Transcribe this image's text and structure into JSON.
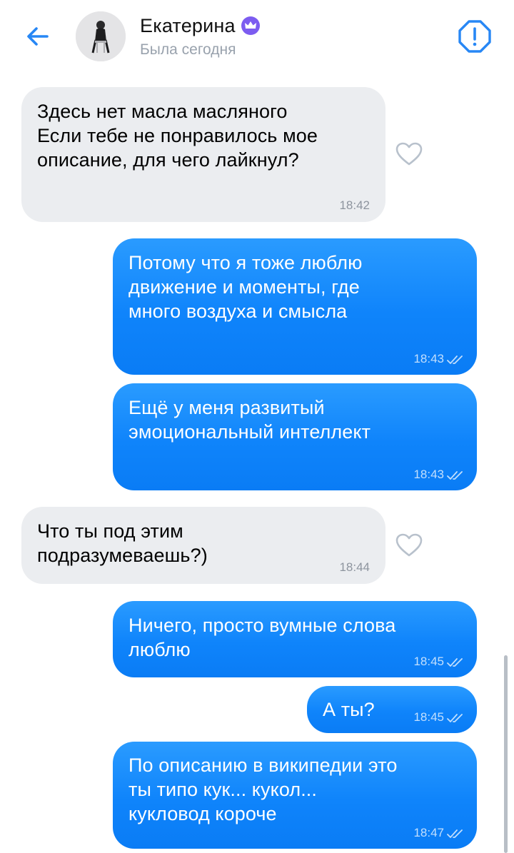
{
  "header": {
    "name": "Екатерина",
    "last_seen": "Была сегодня",
    "icons": {
      "back": "arrow-left-icon",
      "badge": "crown-icon",
      "report": "exclamation-octagon-icon"
    },
    "colors": {
      "accent": "#2787f5",
      "badge": "#7c5cf0"
    }
  },
  "messages": [
    {
      "direction": "incoming",
      "text": "Здесь нет масла масляного\nЕсли тебе не понравилось мое\nописание, для чего лайкнул?",
      "time": "18:42",
      "like": "heart-outline-icon"
    },
    {
      "direction": "outgoing",
      "text": "Потому что я тоже люблю\nдвижение и моменты, где\nмного воздуха и смысла",
      "time": "18:43",
      "status": "double-check-icon"
    },
    {
      "direction": "outgoing",
      "text": "Ещё у меня развитый\nэмоциональный интеллект",
      "time": "18:43",
      "status": "double-check-icon"
    },
    {
      "direction": "incoming",
      "text": "Что ты под этим\nподразумеваешь?)",
      "time": "18:44",
      "like": "heart-outline-icon"
    },
    {
      "direction": "outgoing",
      "text": "Ничего, просто вумные слова\nлюблю",
      "time": "18:45",
      "status": "double-check-icon"
    },
    {
      "direction": "outgoing",
      "text": "А ты?",
      "time": "18:45",
      "status": "double-check-icon"
    },
    {
      "direction": "outgoing",
      "text": "По описанию в википедии это\nты типо кук... кукол...\nкукловод короче",
      "time": "18:47",
      "status": "double-check-icon"
    }
  ],
  "colors": {
    "incoming_bubble": "#ebedf0",
    "outgoing_bubble": "#0f84fb",
    "time_incoming": "#8d949e",
    "icon_gray": "#b8c1cc"
  }
}
